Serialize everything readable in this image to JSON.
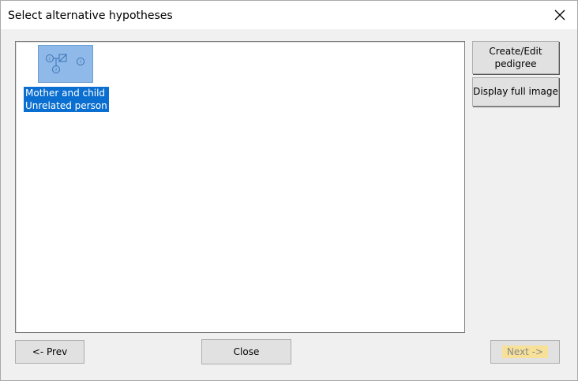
{
  "window": {
    "title": "Select alternative hypotheses"
  },
  "hypotheses_list": {
    "items": [
      {
        "line1": "Mother and child",
        "line2": "Unrelated person",
        "selected": true,
        "thumbnail_icon": "pedigree-thumbnail-icon"
      }
    ]
  },
  "side_buttons": {
    "create_edit_line1": "Create/Edit",
    "create_edit_line2": "pedigree",
    "display_full_image": "Display full image"
  },
  "footer": {
    "prev_label": "<- Prev",
    "close_label": "Close",
    "next_label": "Next ->",
    "next_enabled": false
  },
  "colors": {
    "selection": "#0a6fd0",
    "thumbnail_bg": "#8fb9e8",
    "next_highlight": "#f7e199"
  }
}
